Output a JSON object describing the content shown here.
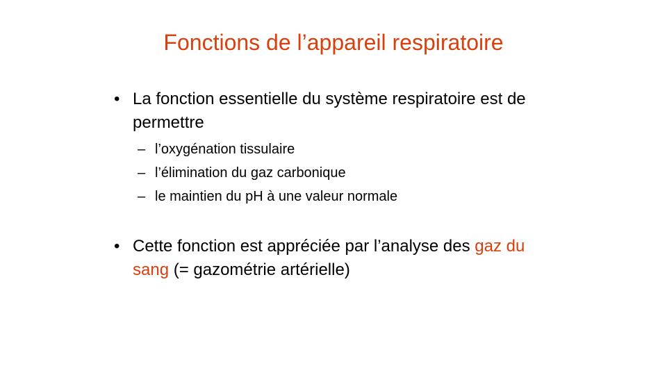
{
  "slide": {
    "title": "Fonctions de l’appareil respiratoire",
    "accent_color": "#d9400d",
    "bullet_symbol": "•",
    "dash_symbol": "–",
    "bullets": [
      {
        "text": "La fonction essentielle du système respiratoire est de permettre",
        "subitems": [
          "l’oxygénation tissulaire",
          "l’élimination du gaz carbonique",
          "le maintien du pH à une valeur normale"
        ]
      },
      {
        "text_before": "Cette fonction est appréciée par l’analyse des ",
        "highlight": "gaz du sang",
        "text_after": " (= gazométrie artérielle)"
      }
    ]
  }
}
